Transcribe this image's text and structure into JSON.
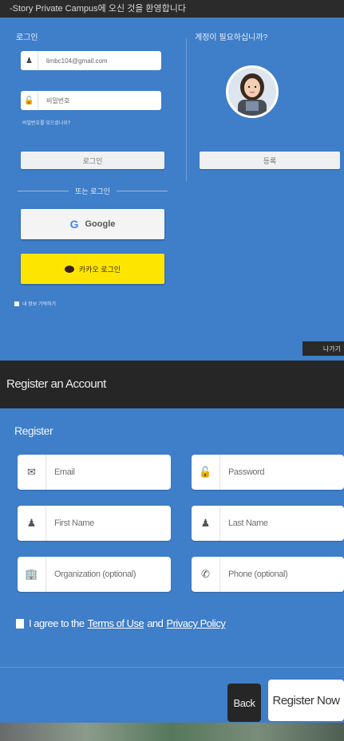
{
  "top_bar": {
    "text": "-Story Private Campus에 오신 것을 환영합니다"
  },
  "login": {
    "section_title": "로그인",
    "email_value": "limbc104@gmail.com",
    "password_placeholder": "비밀번호",
    "forgot_link": "비밀번호를 잊으셨나요?",
    "login_button": "로그인",
    "or_label": "또는 로그인",
    "google_button": "Google",
    "kakao_button": "카카오 로그인",
    "remember_label": "내 정보 기억하기"
  },
  "signup": {
    "question": "계정이 필요하십니까?",
    "register_button": "등록"
  },
  "exit_button": "나가기",
  "register": {
    "header": "Register an Account",
    "title": "Register",
    "fields": {
      "email": "Email",
      "password": "Password",
      "first_name": "First Name",
      "last_name": "Last Name",
      "organization": "Organization (optional)",
      "phone": "Phone (optional)"
    },
    "agree_prefix": "I agree to the",
    "terms_link": "Terms of Use",
    "and": "and",
    "privacy_link": "Privacy Policy",
    "back_button": "Back",
    "submit_button": "Register Now"
  },
  "icons": {
    "user": "user-icon",
    "lock": "lock-icon",
    "email": "envelope-icon",
    "building": "building-icon",
    "phone": "phone-icon",
    "google": "google-icon",
    "kakao": "kakao-icon"
  },
  "colors": {
    "panel_blue": "#3f7ec8",
    "header_dark": "#262626",
    "kakao_yellow": "#fde500"
  }
}
